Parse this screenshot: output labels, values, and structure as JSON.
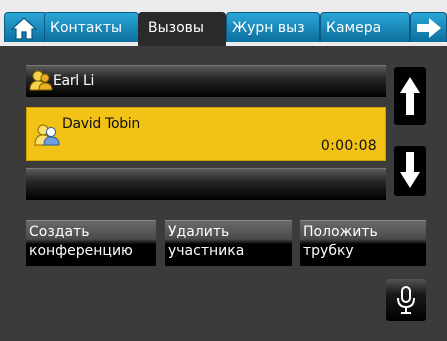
{
  "tabs": [
    {
      "id": "home",
      "label": "",
      "icon": "home-icon"
    },
    {
      "id": "contacts",
      "label": "Контакты"
    },
    {
      "id": "calls",
      "label": "Вызовы",
      "active": true
    },
    {
      "id": "log",
      "label": "Журн выз"
    },
    {
      "id": "camera",
      "label": "Камера"
    },
    {
      "id": "next",
      "label": "",
      "icon": "arrow-right-icon"
    }
  ],
  "calls": [
    {
      "name": "Earl Li",
      "duration": "",
      "state": "held"
    },
    {
      "name": "David Tobin",
      "duration": "0:00:08",
      "state": "active"
    },
    {
      "name": "",
      "duration": "",
      "state": "empty"
    }
  ],
  "actions": {
    "conference": {
      "line1": "Создать",
      "line2": "конференцию"
    },
    "remove": {
      "line1": "Удалить",
      "line2": "участника"
    },
    "hangup": {
      "line1": "Положить",
      "line2": "трубку"
    }
  },
  "colors": {
    "tab_blue": "#1b8dc0",
    "active_call": "#f2c217",
    "background": "#3b3b3b"
  }
}
